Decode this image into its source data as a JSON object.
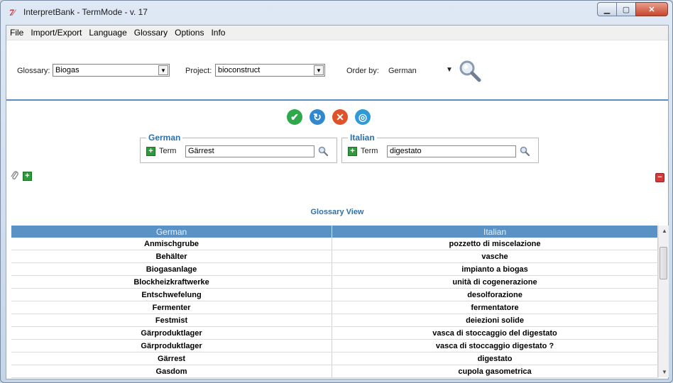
{
  "window": {
    "title": "InterpretBank - TermMode - v. 17",
    "icon_text": "7⁄"
  },
  "menu": [
    "File",
    "Import/Export",
    "Language",
    "Glossary",
    "Options",
    "Info"
  ],
  "toolbar": {
    "glossary_label": "Glossary:",
    "glossary_value": "Biogas",
    "project_label": "Project:",
    "project_value": "bioconstruct",
    "order_label": "Order by:",
    "order_value": "German"
  },
  "actions": [
    {
      "name": "confirm",
      "color": "#2ea84a",
      "glyph": "✔"
    },
    {
      "name": "refresh",
      "color": "#2f88d0",
      "glyph": "↻"
    },
    {
      "name": "delete",
      "color": "#e0522a",
      "glyph": "✕"
    },
    {
      "name": "target",
      "color": "#2f9ad8",
      "glyph": "◎"
    }
  ],
  "german": {
    "legend": "German",
    "term_label": "Term",
    "term_value": "Gärrest"
  },
  "italian": {
    "legend": "Italian",
    "term_label": "Term",
    "term_value": "digestato"
  },
  "glossary_view": {
    "title": "Glossary View",
    "columns": [
      "German",
      "Italian"
    ],
    "rows": [
      [
        "Anmischgrube",
        "pozzetto di miscelazione"
      ],
      [
        "Behälter",
        "vasche"
      ],
      [
        "Biogasanlage",
        "impianto a biogas"
      ],
      [
        "Blockheizkraftwerke",
        "unità di cogenerazione"
      ],
      [
        "Entschwefelung",
        "desolforazione"
      ],
      [
        "Fermenter",
        "fermentatore"
      ],
      [
        "Festmist",
        "deiezioni solide"
      ],
      [
        "Gärproduktlager",
        "vasca di stoccaggio del digestato"
      ],
      [
        "Gärproduktlager",
        "vasca di stoccaggio digestato ?"
      ],
      [
        "Gärrest",
        "digestato"
      ],
      [
        "Gasdom",
        "cupola gasometrica"
      ]
    ]
  }
}
